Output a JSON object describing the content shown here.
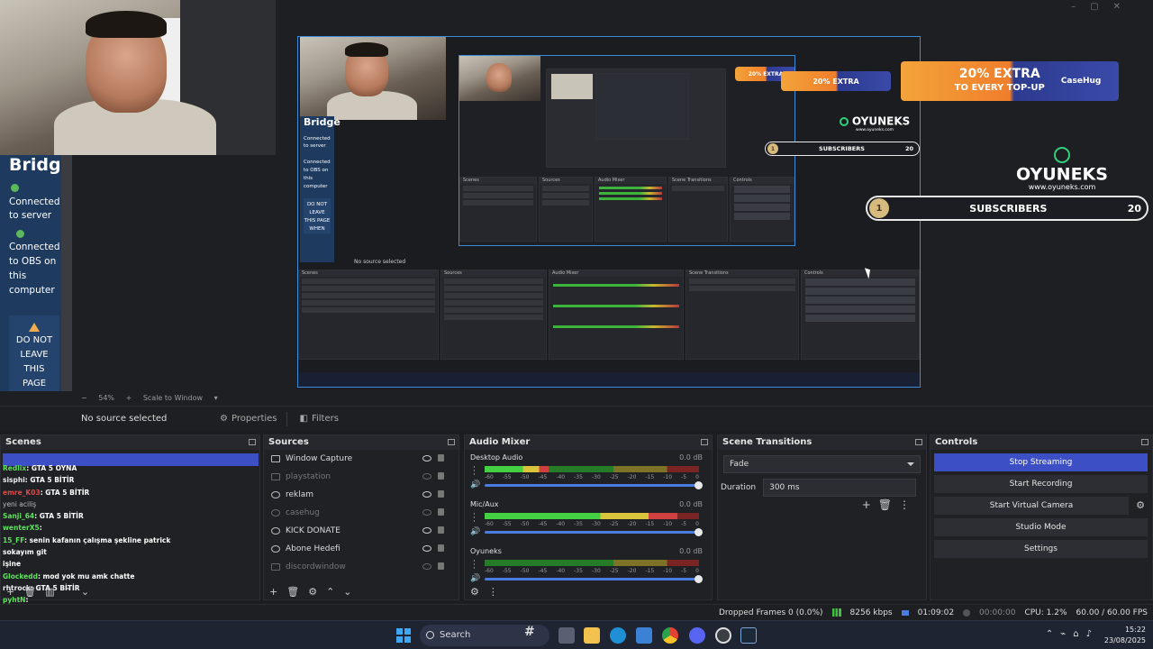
{
  "bridge": {
    "title": "Bridge",
    "connected_server": "Connected to server",
    "connected_obs": "Connected to OBS on this computer",
    "warning": "DO NOT LEAVE THIS PAGE WHEN"
  },
  "overlay": {
    "promo": "20% EXTRA",
    "promo_sub": "TO EVERY TOP-UP",
    "brand": "CaseHug",
    "sponsor_name": "OYUNEKS",
    "sponsor_url": "www.oyuneks.com",
    "sub_count_current": "1",
    "sub_label": "SUBSCRIBERS",
    "sub_goal": "20"
  },
  "zoom": {
    "percent": "54%",
    "mode": "Scale to Window"
  },
  "sourcebar": {
    "no_source": "No source selected",
    "properties": "Properties",
    "filters": "Filters"
  },
  "scenes": {
    "title": "Scenes",
    "chat": [
      {
        "user": "Redlix",
        "text": ": GTA 5 OYNA"
      },
      {
        "user": "sisphi",
        "text": ": GTA 5 BİTİR"
      },
      {
        "user": "emre_K03",
        "text": ": GTA 5 BİTİR"
      },
      {
        "user": "",
        "text": "yeni aciliş"
      },
      {
        "user": "Sanji_64",
        "text": ": GTA 5 BİTİR"
      },
      {
        "user": "wenterX5",
        "text": ":"
      },
      {
        "user": "15_FF",
        "text": ": senin kafanın çalışma şekline patrick sokayım git"
      },
      {
        "user": "",
        "text": "işine"
      },
      {
        "user": "Glockedd",
        "text": ": mod yok mu amk chatte"
      },
      {
        "user": "rhtrock",
        "text": ": GTA 5 BİTİR"
      },
      {
        "user": "pyhtN",
        "text": ":"
      }
    ]
  },
  "sources": {
    "title": "Sources",
    "items": [
      {
        "name": "Window Capture",
        "visible": true
      },
      {
        "name": "playstation",
        "visible": false
      },
      {
        "name": "reklam",
        "visible": true
      },
      {
        "name": "casehug",
        "visible": false
      },
      {
        "name": "KICK DONATE",
        "visible": true
      },
      {
        "name": "Abone Hedefi",
        "visible": true
      },
      {
        "name": "discordwindow",
        "visible": false
      }
    ]
  },
  "mixer": {
    "title": "Audio Mixer",
    "channels": [
      {
        "name": "Desktop Audio",
        "db": "0.0 dB",
        "level": 0.3
      },
      {
        "name": "Mic/Aux",
        "db": "0.0 dB",
        "level": 0.9
      },
      {
        "name": "Oyuneks",
        "db": "0.0 dB",
        "level": 0.0
      }
    ],
    "scale": [
      "-60",
      "-55",
      "-50",
      "-45",
      "-40",
      "-35",
      "-30",
      "-25",
      "-20",
      "-15",
      "-10",
      "-5",
      "0"
    ]
  },
  "transitions": {
    "title": "Scene Transitions",
    "type": "Fade",
    "duration_label": "Duration",
    "duration": "300 ms"
  },
  "controls": {
    "title": "Controls",
    "stop_streaming": "Stop Streaming",
    "start_recording": "Start Recording",
    "start_virtual_camera": "Start Virtual Camera",
    "studio_mode": "Studio Mode",
    "settings": "Settings"
  },
  "status": {
    "dropped": "Dropped Frames 0 (0.0%)",
    "bitrate": "8256 kbps",
    "live_time": "01:09:02",
    "rec_time": "00:00:00",
    "cpu": "CPU: 1.2%",
    "fps": "60.00 / 60.00 FPS"
  },
  "taskbar": {
    "search": "Search",
    "time": "15:22",
    "date": "23/08/2025"
  }
}
